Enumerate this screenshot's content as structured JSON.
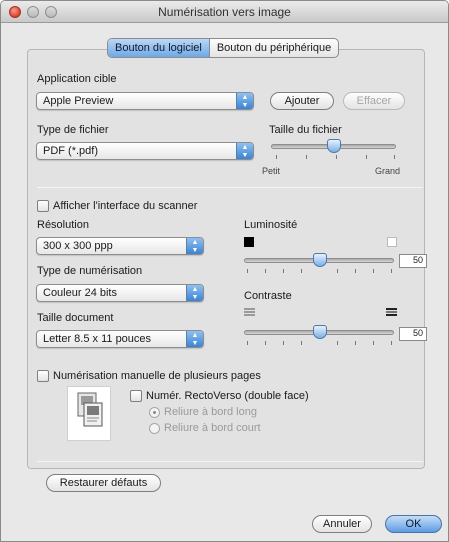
{
  "window": {
    "title": "Numérisation vers image"
  },
  "tabs": [
    {
      "label": "Bouton du logiciel"
    },
    {
      "label": "Bouton du périphérique"
    }
  ],
  "application": {
    "label": "Application cible",
    "value": "Apple Preview",
    "add_label": "Ajouter",
    "remove_label": "Effacer"
  },
  "file": {
    "type_label": "Type de fichier",
    "type_value": "PDF (*.pdf)",
    "size_label": "Taille du fichier",
    "size_min_label": "Petit",
    "size_max_label": "Grand",
    "size_level": 0.5
  },
  "scanner": {
    "show_interface_label": "Afficher l'interface du scanner",
    "show_interface_checked": false,
    "resolution_label": "Résolution",
    "resolution_value": "300 x 300 ppp",
    "scan_type_label": "Type de numérisation",
    "scan_type_value": "Couleur 24 bits",
    "doc_size_label": "Taille document",
    "doc_size_value": "Letter  8.5 x 11 pouces"
  },
  "brightness": {
    "label": "Luminosité",
    "value": "50",
    "level": 0.5
  },
  "contrast": {
    "label": "Contraste",
    "value": "50",
    "level": 0.5
  },
  "manual": {
    "multi_page_label": "Numérisation manuelle de plusieurs pages",
    "multi_page_checked": false,
    "duplex_label": "Numér. RectoVerso (double face)",
    "duplex_checked": false,
    "long_edge_label": "Reliure à bord long",
    "short_edge_label": "Reliure à bord court"
  },
  "footer": {
    "restore_label": "Restaurer défauts",
    "cancel_label": "Annuler",
    "ok_label": "OK"
  },
  "colors": {
    "accent": "#5e9de3",
    "close_button": "#d8432f"
  }
}
